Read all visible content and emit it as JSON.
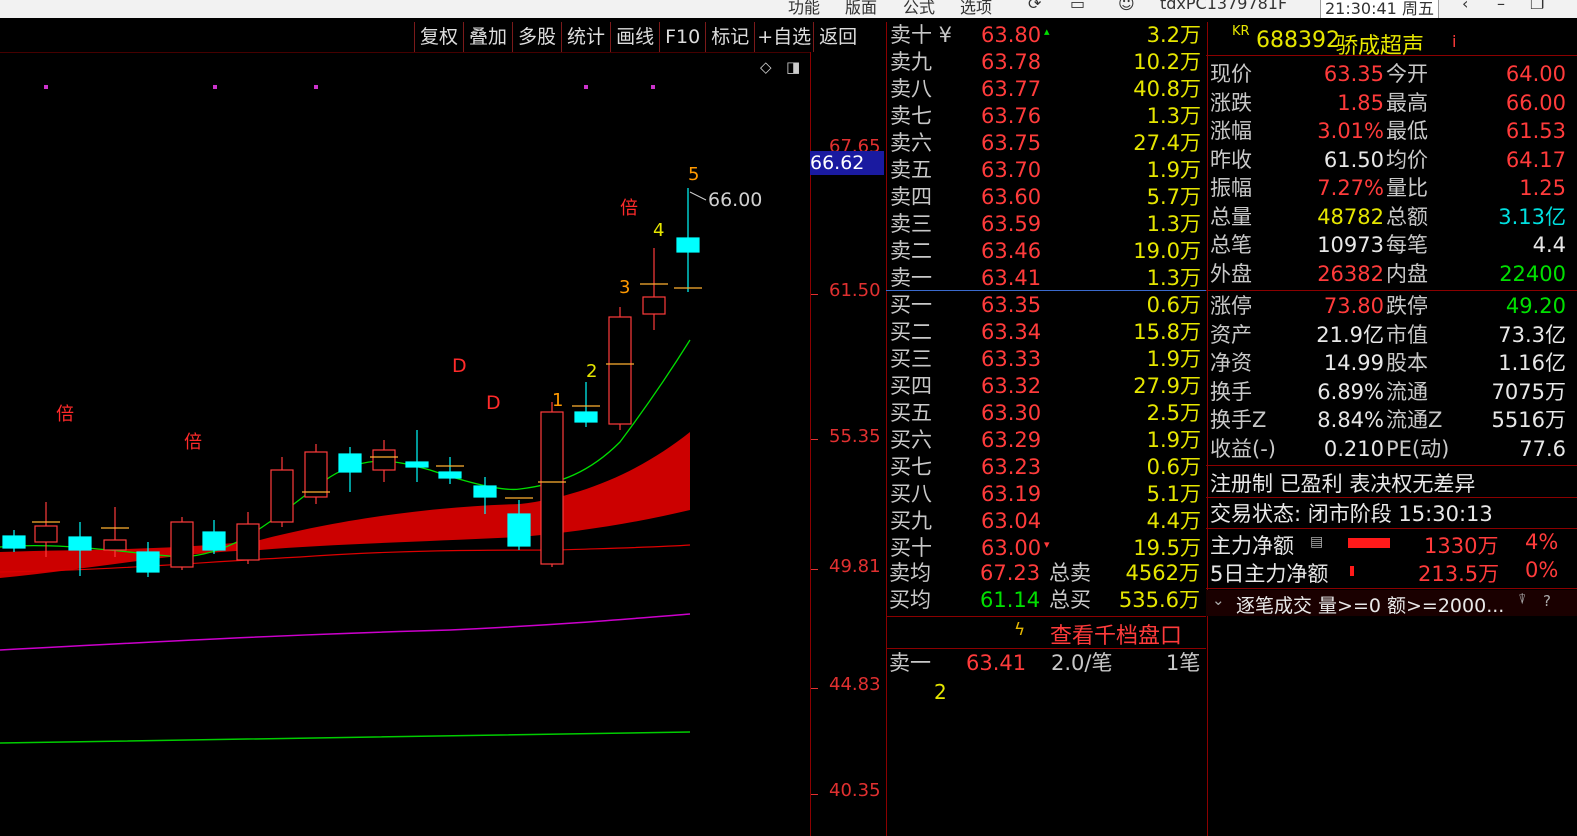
{
  "topbar": {
    "items": [
      "功能",
      "版面",
      "公式",
      "选项"
    ],
    "user": "tdxPC1379781F",
    "clock": "21:30:41 周五"
  },
  "toolbar": [
    "复权",
    "叠加",
    "多股",
    "统计",
    "画线",
    "F10",
    "标记",
    "+自选",
    "返回"
  ],
  "chart": {
    "price_axis": [
      "67.65",
      "61.50",
      "55.35",
      "49.81",
      "44.83",
      "40.35"
    ],
    "cursor_price": "66.62",
    "high_label": "66.00",
    "labels": {
      "bei1": "倍",
      "bei2": "倍",
      "bei3": "倍",
      "d1": "D",
      "d2": "D",
      "n1": "1",
      "n2": "2",
      "n3": "3",
      "n4": "4",
      "n5": "5"
    }
  },
  "orderbook": {
    "asks": [
      {
        "label": "卖十 ¥",
        "price": "63.80",
        "vol": "3.2万",
        "mark": "▴"
      },
      {
        "label": "卖九",
        "price": "63.78",
        "vol": "10.2万"
      },
      {
        "label": "卖八",
        "price": "63.77",
        "vol": "40.8万"
      },
      {
        "label": "卖七",
        "price": "63.76",
        "vol": "1.3万"
      },
      {
        "label": "卖六",
        "price": "63.75",
        "vol": "27.4万"
      },
      {
        "label": "卖五",
        "price": "63.70",
        "vol": "1.9万"
      },
      {
        "label": "卖四",
        "price": "63.60",
        "vol": "5.7万"
      },
      {
        "label": "卖三",
        "price": "63.59",
        "vol": "1.3万"
      },
      {
        "label": "卖二",
        "price": "63.46",
        "vol": "19.0万"
      },
      {
        "label": "卖一",
        "price": "63.41",
        "vol": "1.3万"
      }
    ],
    "bids": [
      {
        "label": "买一",
        "price": "63.35",
        "vol": "0.6万"
      },
      {
        "label": "买二",
        "price": "63.34",
        "vol": "15.8万"
      },
      {
        "label": "买三",
        "price": "63.33",
        "vol": "1.9万"
      },
      {
        "label": "买四",
        "price": "63.32",
        "vol": "27.9万"
      },
      {
        "label": "买五",
        "price": "63.30",
        "vol": "2.5万"
      },
      {
        "label": "买六",
        "price": "63.29",
        "vol": "1.9万"
      },
      {
        "label": "买七",
        "price": "63.23",
        "vol": "0.6万"
      },
      {
        "label": "买八",
        "price": "63.19",
        "vol": "5.1万"
      },
      {
        "label": "买九",
        "price": "63.04",
        "vol": "4.4万"
      },
      {
        "label": "买十",
        "price": "63.00",
        "vol": "19.5万",
        "mark": "▾"
      }
    ],
    "avg_sell": {
      "label": "卖均",
      "price": "67.23",
      "total_label": "总卖",
      "total": "4562万"
    },
    "avg_buy": {
      "label": "买均",
      "price": "61.14",
      "total_label": "总买",
      "total": "535.6万"
    },
    "deep_book": "查看千档盘口",
    "trade": {
      "label": "卖一",
      "price": "63.41",
      "per": "2.0/笔",
      "count": "1笔",
      "sub": "2"
    }
  },
  "quote": {
    "kr": "KR",
    "code": "688392",
    "name": "骄成超声",
    "info_icon": "i",
    "rows": [
      [
        "现价",
        "63.35",
        "今开",
        "64.00"
      ],
      [
        "涨跌",
        "1.85",
        "最高",
        "66.00"
      ],
      [
        "涨幅",
        "3.01%",
        "最低",
        "61.53"
      ],
      [
        "昨收",
        "61.50",
        "均价",
        "64.17"
      ],
      [
        "振幅",
        "7.27%",
        "量比",
        "1.25"
      ],
      [
        "总量",
        "48782",
        "总额",
        "3.13亿"
      ],
      [
        "总笔",
        "10973",
        "每笔",
        "4.4"
      ],
      [
        "外盘",
        "26382",
        "内盘",
        "22400"
      ]
    ],
    "rows2": [
      [
        "涨停",
        "73.80",
        "跌停",
        "49.20"
      ],
      [
        "资产",
        "21.9亿",
        "市值",
        "73.3亿"
      ],
      [
        "净资",
        "14.99",
        "股本",
        "1.16亿"
      ],
      [
        "换手",
        "6.89%",
        "流通",
        "7075万"
      ],
      [
        "换手Z",
        "8.84%",
        "流通Z",
        "5516万"
      ],
      [
        "收益(-)",
        "0.210",
        "PE(动)",
        "77.6"
      ]
    ],
    "reg": "注册制 已盈利 表决权无差异",
    "status": "交易状态: 闭市阶段 15:30:13",
    "main_net": {
      "label": "主力净额",
      "value": "1330万",
      "pct": "4%"
    },
    "main_net5": {
      "label": "5日主力净额",
      "value": "213.5万",
      "pct": "0%"
    },
    "tick": "逐笔成交  量>=0 额>=2000...",
    "colors": {
      "up": "#ff3b3b",
      "down": "#00e000",
      "vol": "#e6e600",
      "bg": "#000000"
    }
  }
}
